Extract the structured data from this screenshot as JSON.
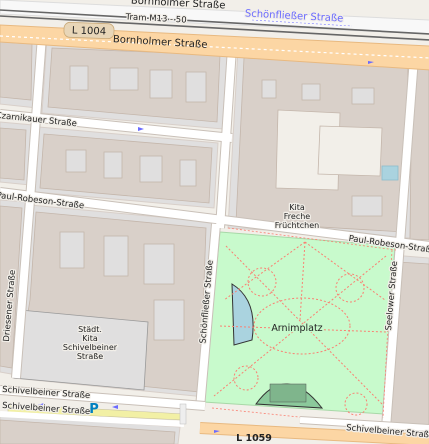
{
  "streets": {
    "bornholmer_top": "Bornholmer Straße",
    "bornholmer_main": "Bornholmer Straße",
    "schonfliesser_top": "Schönfließer Straße",
    "czarnikauer": "Czarnikauer Straße",
    "paul_robeson_left": "Paul-Robeson-Straße",
    "paul_robeson_right": "Paul-Robeson-Straße",
    "dresener": "Driesener Straße",
    "schonfliesser_vertical": "Schönfließer Straße",
    "seelower": "Seelower Straße",
    "schivelbeiner_1": "Schivelbeiner Straße",
    "schivelbeiner_2": "Schivelbeiner Straße",
    "schivelbeiner_right": "Schivelbeiner Straße"
  },
  "transit": {
    "tram_label": "Tram M13 - 50"
  },
  "road_refs": {
    "l1004": "L 1004",
    "l1059": "L 1059"
  },
  "places": {
    "park": "Arnimplatz"
  },
  "pois": {
    "kita_freche": [
      "Kita",
      "Freche",
      "Früchtchen"
    ],
    "stadt_kita": [
      "Städt.",
      "Kita",
      "Schivelbeiner",
      "Straße"
    ],
    "parking_symbol": "P"
  },
  "colors": {
    "background": "#f2efe9",
    "building": "#d9d0c9",
    "building_outline": "#c4b6ab",
    "block": "#e0dfdf",
    "primary_road": "#fcd6a4",
    "road_casing": "#e8b980",
    "park": "#c8facc",
    "park_path": "#fa8072",
    "water": "#aad3df",
    "parking": "#0080c0",
    "rail": "#666666"
  }
}
